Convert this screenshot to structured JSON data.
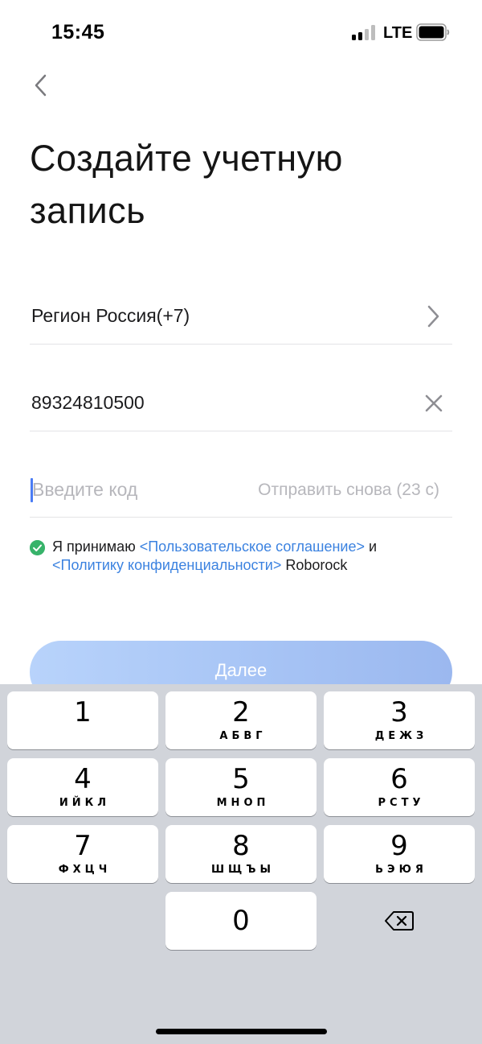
{
  "status_bar": {
    "time": "15:45",
    "network": "LTE",
    "signal_bars_active": 2,
    "signal_bars_total": 4,
    "icons": [
      "signal-icon",
      "battery-icon"
    ]
  },
  "header": {
    "back_icon": "chevron-left-icon",
    "title": "Создайте учетную запись"
  },
  "form": {
    "region": {
      "label": "Регион Россия(+7)",
      "icon": "chevron-right-icon"
    },
    "phone": {
      "value": "89324810500",
      "clear_icon": "close-icon"
    },
    "code": {
      "placeholder": "Введите код",
      "value": "",
      "resend": "Отправить снова (23 с)"
    }
  },
  "agreement": {
    "checked": true,
    "prefix": "Я принимаю ",
    "terms_link": "<Пользовательское соглашение>",
    "conjunction": " и ",
    "privacy_link": "<Политику конфиденциальности>",
    "suffix": " Roborock"
  },
  "next_button": {
    "label": "Далее"
  },
  "keyboard": {
    "keys": [
      {
        "digit": "1",
        "letters": ""
      },
      {
        "digit": "2",
        "letters": "АБВГ"
      },
      {
        "digit": "3",
        "letters": "ДЕЖЗ"
      },
      {
        "digit": "4",
        "letters": "ИЙКЛ"
      },
      {
        "digit": "5",
        "letters": "МНОП"
      },
      {
        "digit": "6",
        "letters": "РСТУ"
      },
      {
        "digit": "7",
        "letters": "ФХЦЧ"
      },
      {
        "digit": "8",
        "letters": "ШЩЪЫ"
      },
      {
        "digit": "9",
        "letters": "ЬЭЮЯ"
      },
      {
        "digit": "0",
        "letters": ""
      }
    ],
    "delete_icon": "backspace-icon"
  },
  "colors": {
    "accent_link": "#3b82e0",
    "check_green": "#37b36a",
    "button_gradient_start": "#b8d3fb",
    "button_gradient_end": "#9bb8ef",
    "keyboard_bg": "#d1d4da",
    "placeholder": "#b7b7bc"
  }
}
